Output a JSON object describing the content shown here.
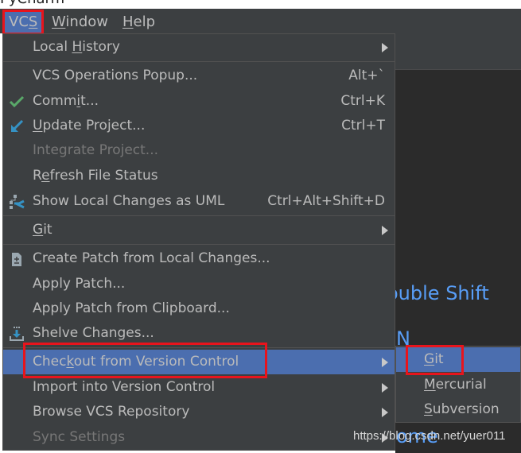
{
  "window": {
    "partial_title": "PyCharm"
  },
  "menubar": {
    "items": [
      {
        "label": "VCS",
        "mnemonic_index": 2,
        "active": true
      },
      {
        "label": "Window",
        "mnemonic_index": 0
      },
      {
        "label": "Help",
        "mnemonic_index": 0
      }
    ]
  },
  "vcs_menu": {
    "items": [
      {
        "label_pre": "Local ",
        "mn": "H",
        "label_post": "istory",
        "submenu": true
      },
      {
        "label_pre": "VCS Operations Popup...",
        "mn": "",
        "label_post": "",
        "shortcut": "Alt+`"
      },
      {
        "label_pre": "Comm",
        "mn": "i",
        "label_post": "t...",
        "shortcut": "Ctrl+K",
        "icon": "check-icon"
      },
      {
        "label_pre": "",
        "mn": "U",
        "label_post": "pdate Project...",
        "shortcut": "Ctrl+T",
        "icon": "update-arrow-icon"
      },
      {
        "label_pre": "Integrate Project...",
        "mn": "",
        "label_post": "",
        "disabled": true
      },
      {
        "label_pre": "R",
        "mn": "e",
        "label_post": "fresh File Status"
      },
      {
        "label_pre": "Show Local Changes as UML",
        "mn": "",
        "label_post": "",
        "shortcut": "Ctrl+Alt+Shift+D",
        "icon": "uml-diagram-icon"
      },
      {
        "label_pre": "",
        "mn": "G",
        "label_post": "it",
        "submenu": true
      },
      {
        "label_pre": "Create Patch from Local Changes...",
        "mn": "",
        "label_post": "",
        "icon": "patch-file-icon"
      },
      {
        "label_pre": "Apply Patch...",
        "mn": "",
        "label_post": ""
      },
      {
        "label_pre": "Apply Patch from Clipboard...",
        "mn": "",
        "label_post": ""
      },
      {
        "label_pre": "Shelve Changes...",
        "mn": "",
        "label_post": "",
        "icon": "shelve-icon"
      },
      {
        "label_pre": "Chec",
        "mn": "k",
        "label_post": "out from Version Control",
        "submenu": true,
        "selected": true
      },
      {
        "label_pre": "Import into Version Control",
        "mn": "",
        "label_post": "",
        "submenu": true
      },
      {
        "label_pre": "Browse VCS Repository",
        "mn": "",
        "label_post": "",
        "submenu": true
      },
      {
        "label_pre": "Sync Settings",
        "mn": "",
        "label_post": "",
        "disabled": true,
        "submenu": true
      }
    ]
  },
  "checkout_submenu": {
    "items": [
      {
        "mn": "G",
        "label_post": "it",
        "selected": true
      },
      {
        "mn": "M",
        "label_post": "ercurial"
      },
      {
        "mn": "S",
        "label_post": "ubversion"
      }
    ]
  },
  "editor": {
    "hint_partial": "ouble Shift",
    "hint_partial_2": "N",
    "hint_partial_3": "ome"
  },
  "watermark": "https://blog.csdn.net/yuer011",
  "colors": {
    "menu_bg": "#3c3f41",
    "selection": "#4b6eaf",
    "highlight_box": "#e8141c",
    "hint_blue": "#589df6",
    "editor_bg": "#2b2b2b"
  }
}
